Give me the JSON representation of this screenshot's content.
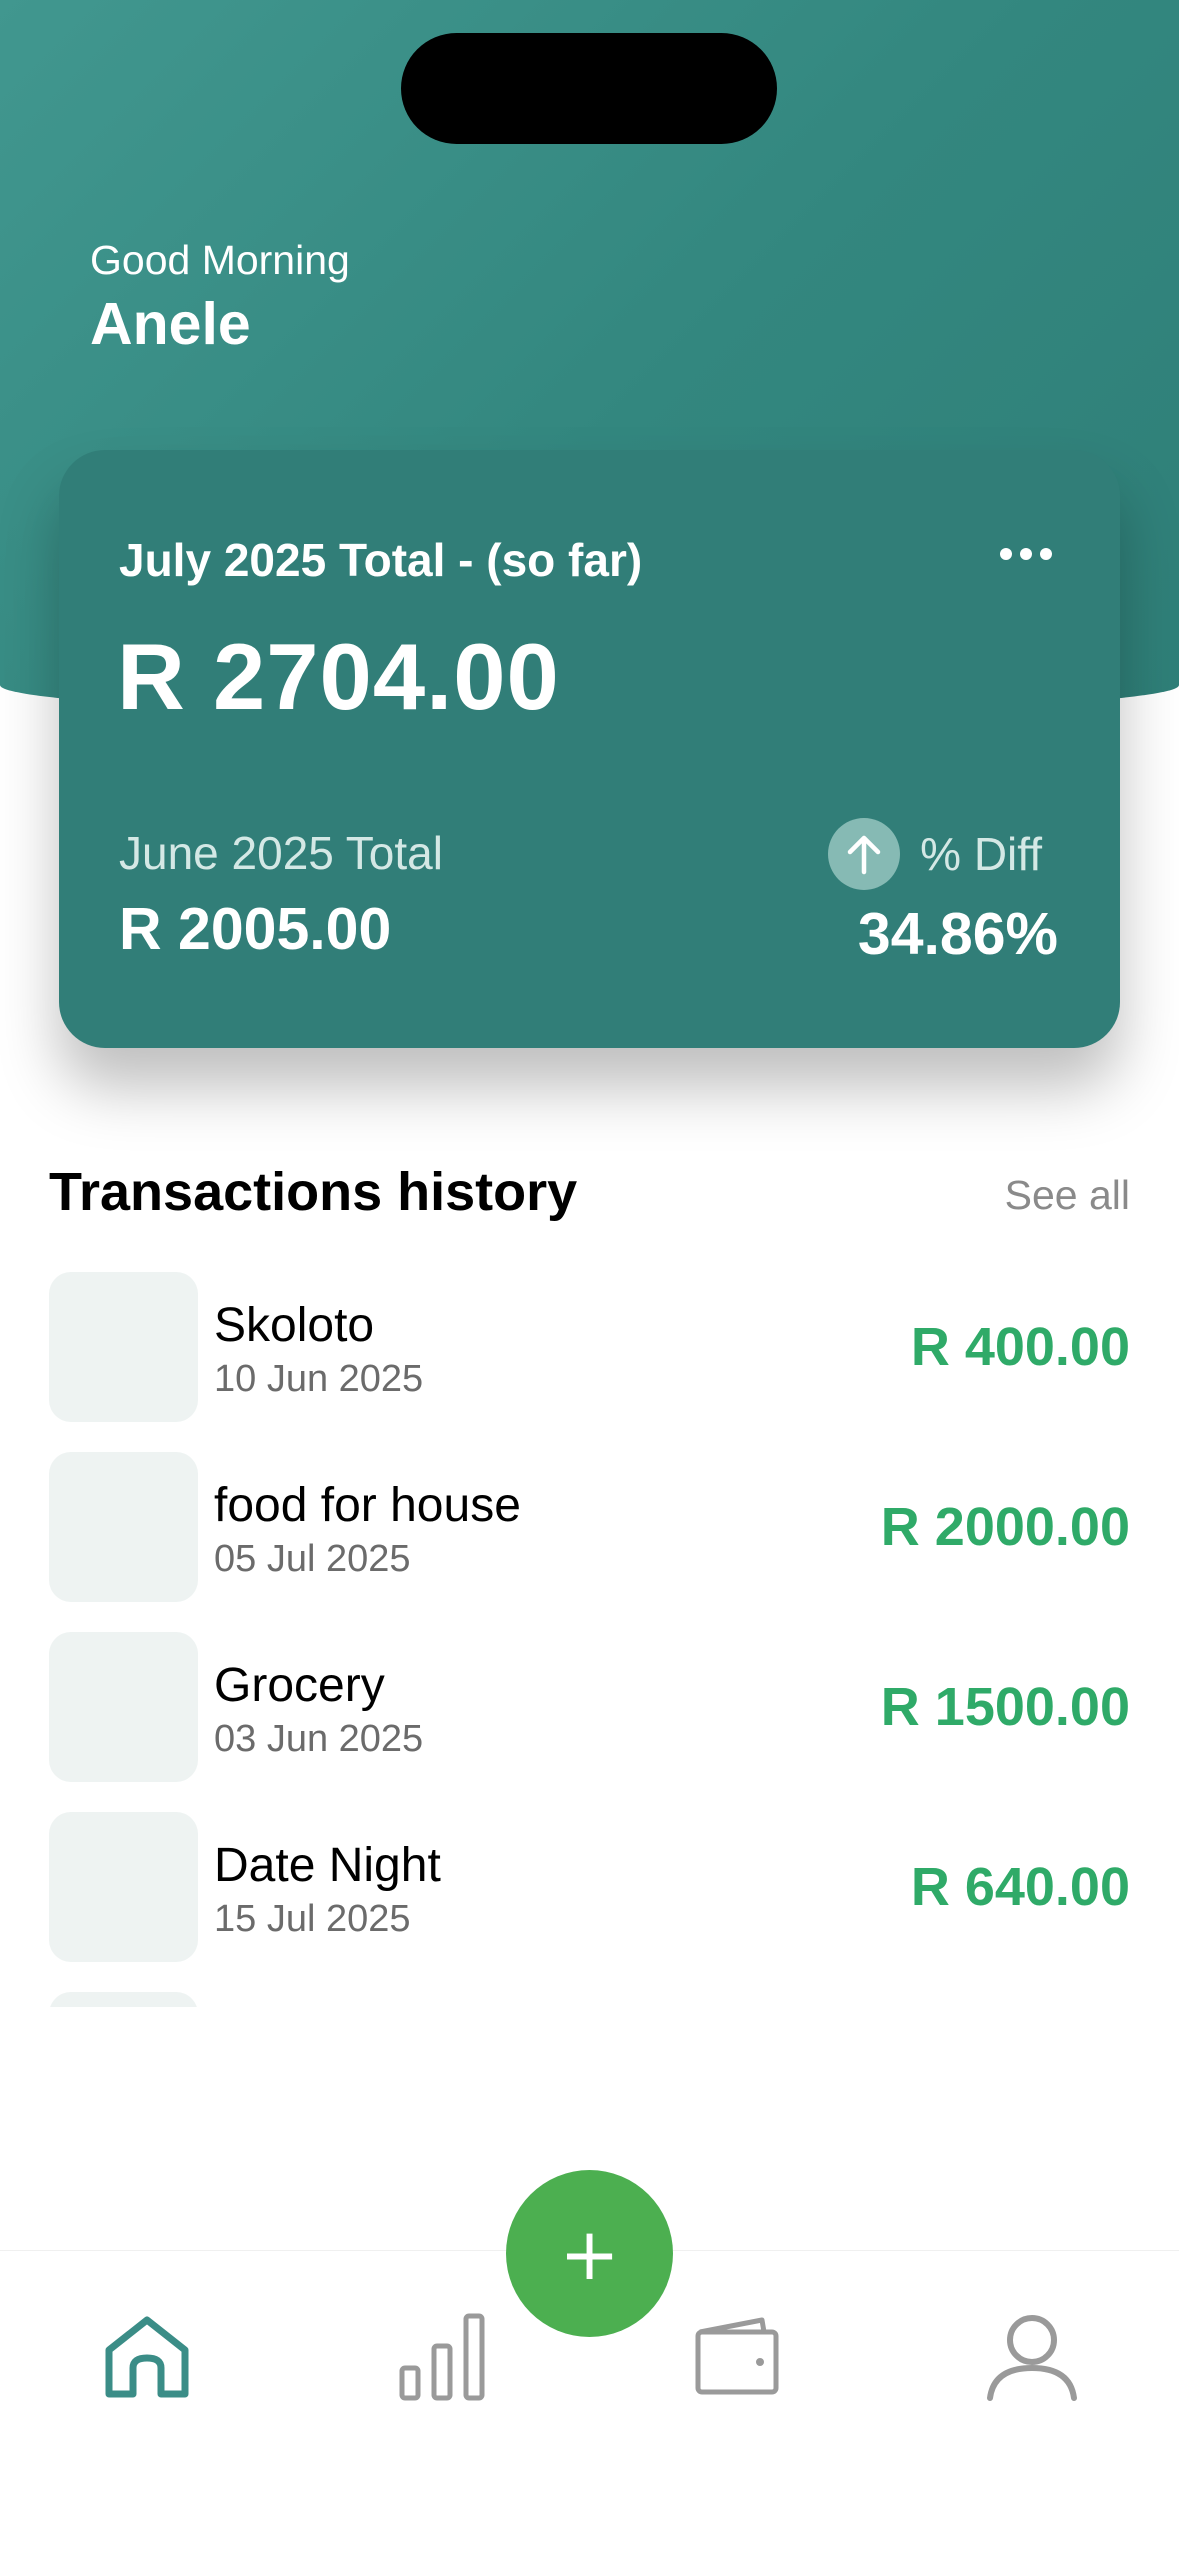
{
  "header": {
    "greeting": "Good Morning",
    "username": "Anele"
  },
  "summary_card": {
    "title": "July 2025 Total - (so far)",
    "current_total": "R 2704.00",
    "previous_label": "June 2025 Total",
    "previous_total": "R 2005.00",
    "diff_label": "% Diff",
    "diff_value": "34.86%",
    "more_icon": "ellipsis-icon",
    "trend_icon": "arrow-up-icon"
  },
  "transactions": {
    "title": "Transactions history",
    "see_all_label": "See all",
    "items": [
      {
        "name": "Skoloto",
        "date": "10 Jun 2025",
        "amount": "R 400.00"
      },
      {
        "name": "food for house",
        "date": "05 Jul 2025",
        "amount": "R 2000.00"
      },
      {
        "name": "Grocery",
        "date": "03 Jun 2025",
        "amount": "R 1500.00"
      },
      {
        "name": "Date Night",
        "date": "15 Jul 2025",
        "amount": "R 640.00"
      }
    ]
  },
  "bottom_nav": {
    "items": [
      {
        "icon": "home-icon",
        "active": true
      },
      {
        "icon": "bar-chart-icon",
        "active": false
      },
      {
        "icon": "wallet-icon",
        "active": false
      },
      {
        "icon": "profile-icon",
        "active": false
      }
    ],
    "fab_label": "+"
  },
  "colors": {
    "primary": "#317e78",
    "header_gradient_start": "#41978f",
    "accent_green": "#4caf50",
    "amount_green": "#2faa68",
    "nav_active": "#3b8d87",
    "nav_inactive": "#9a9a9a"
  }
}
